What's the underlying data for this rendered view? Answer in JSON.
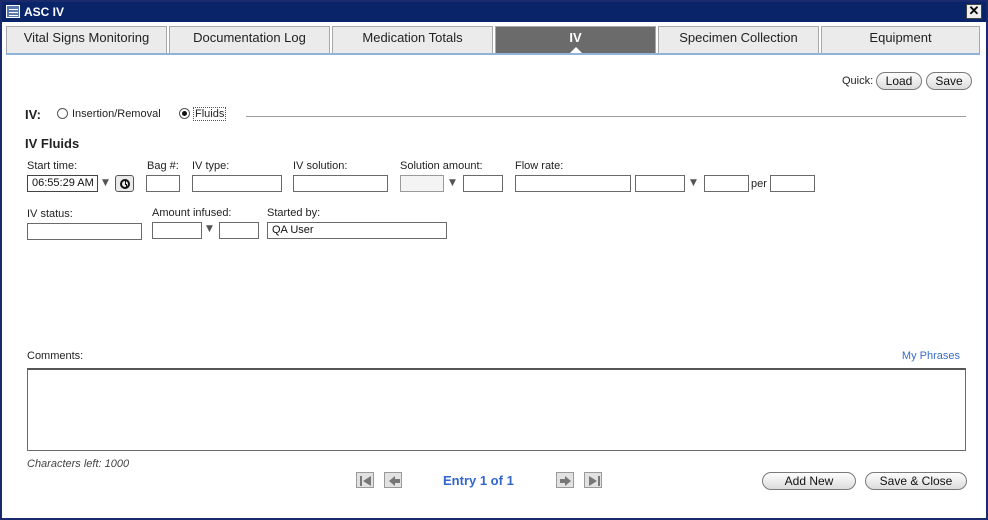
{
  "window": {
    "title": "ASC IV",
    "close_label": "✕"
  },
  "tabs": [
    {
      "label": "Vital Signs Monitoring"
    },
    {
      "label": "Documentation Log"
    },
    {
      "label": "Medication Totals"
    },
    {
      "label": "IV",
      "active": true
    },
    {
      "label": "Specimen Collection"
    },
    {
      "label": "Equipment"
    }
  ],
  "quick": {
    "label": "Quick:",
    "load_label": "Load",
    "save_label": "Save"
  },
  "iv_mode": {
    "label": "IV:",
    "options": [
      "Insertion/Removal",
      "Fluids"
    ],
    "selected": "Fluids"
  },
  "section_title": "IV Fluids",
  "fields": {
    "start_time": {
      "label": "Start time:",
      "value": "06:55:29 AM"
    },
    "bag": {
      "label": "Bag #:",
      "value": ""
    },
    "iv_type": {
      "label": "IV type:",
      "value": ""
    },
    "iv_solution": {
      "label": "IV solution:",
      "value": ""
    },
    "solution_amount": {
      "label": "Solution amount:",
      "unit_value": "",
      "value": ""
    },
    "flow_rate": {
      "label": "Flow rate:",
      "value": "",
      "unit_value": "",
      "amount": "",
      "per_label": "per",
      "per_value": ""
    },
    "iv_status": {
      "label": "IV status:",
      "value": ""
    },
    "amount_infused": {
      "label": "Amount infused:",
      "value": "",
      "unit_value": ""
    },
    "started_by": {
      "label": "Started by:",
      "value": "QA User"
    }
  },
  "comments": {
    "label": "Comments:",
    "my_phrases_label": "My Phrases",
    "chars_left": "Characters left: 1000",
    "value": ""
  },
  "footer": {
    "entry_text": "Entry 1 of 1",
    "add_new_label": "Add New",
    "save_close_label": "Save & Close"
  },
  "colors": {
    "titlebar": "#0a246a",
    "active_tab": "#6b6b6b",
    "link": "#3366cc"
  }
}
